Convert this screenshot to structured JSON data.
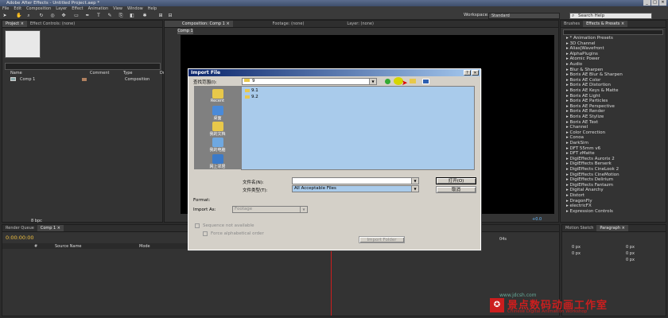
{
  "app": {
    "title": "Adobe After Effects - Untitled Project.aep *",
    "win_controls": [
      "_",
      "□",
      "✕"
    ]
  },
  "menu": [
    "File",
    "Edit",
    "Composition",
    "Layer",
    "Effect",
    "Animation",
    "View",
    "Window",
    "Help"
  ],
  "toolbar": {
    "workspace_label": "Workspace:",
    "workspace_value": "Standard",
    "search_placeholder": "Search Help"
  },
  "project": {
    "tabs": [
      "Project ×",
      "Effect Controls: (none)"
    ],
    "columns": [
      "Name",
      "Comment",
      "Type",
      "Dur"
    ],
    "items": [
      {
        "name": "Comp 1",
        "type": "Composition"
      }
    ],
    "bpc": "8 bpc"
  },
  "viewer": {
    "tabs": [
      "Composition: Comp 1 ×",
      "Footage: (none)",
      "Layer: (none)"
    ],
    "comp_tab": "Comp 1",
    "zoom_value": "+0.0"
  },
  "effects": {
    "tabs": [
      "Brushes",
      "Effects & Presets ×"
    ],
    "items": [
      "* Animation Presets",
      "3D Channel",
      "Alias|Wavefront",
      "AlphaPlugins",
      "Atomic Power",
      "Audio",
      "Blur & Sharpen",
      "Boris AE Blur & Sharpen",
      "Boris AE Color",
      "Boris AE Distortion",
      "Boris AE Keys & Matte",
      "Boris AE Light",
      "Boris AE Particles",
      "Boris AE Perspective",
      "Boris AE Render",
      "Boris AE Stylize",
      "Boris AE Text",
      "Channel",
      "Color Correction",
      "Conoa",
      "DarkSim",
      "DFT 55mm v6",
      "DFT zMatte",
      "DigiEffects Aurorix 2",
      "DigiEffects Berserk",
      "DigiEffects CineLook 2",
      "DigiEffects CineMotion",
      "DigiEffects Delirium",
      "DigiEffects Fantazm",
      "Digital Anarchy",
      "Distort",
      "DragonFly",
      "electricFX",
      "Expression Controls"
    ]
  },
  "bottom": {
    "tabs": [
      "Render Queue",
      "Comp 1 ×"
    ],
    "timecode": "0:00:00:00",
    "layer_headers": [
      "#",
      "Source Name",
      "Mode"
    ],
    "ruler_mark": "04s",
    "right_tabs": [
      "Motion Sketch",
      "Paragraph ×"
    ],
    "para_values": [
      "0 px",
      "0 px",
      "0 px",
      "0 px",
      "0 px"
    ]
  },
  "dialog": {
    "title": "Import File",
    "lookin_label": "查找范围(I):",
    "lookin_value": "9",
    "places": [
      "Recent",
      "桌面",
      "我的文档",
      "我的电脑",
      "网上邻居"
    ],
    "files": [
      "9.1",
      "9.2"
    ],
    "filename_label": "文件名(N):",
    "filetype_label": "文件类型(T):",
    "filetype_value": "All Acceptable Files",
    "open_label": "打开(O)",
    "cancel_label": "取消",
    "format_label": "Format:",
    "importas_label": "Import As:",
    "importas_value": "Footage",
    "sequence_label": "Sequence not available",
    "alpha_label": "Force alphabetical order",
    "import_folder_label": "Import Folder"
  },
  "watermark": {
    "line1": "景点数码动画工作室",
    "line2": "Chinese Digital Animation Workshop",
    "url": "www.jdcsh.com"
  },
  "colors": {
    "accent_red": "#cc1e1e",
    "dialog_bg": "#d4d0c8",
    "list_bg": "#a9cbeb"
  }
}
